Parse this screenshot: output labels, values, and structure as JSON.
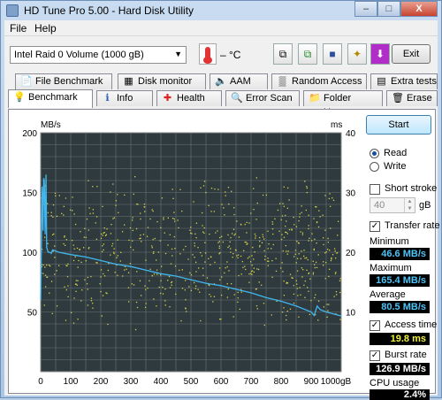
{
  "window": {
    "title": "HD Tune Pro 5.00 - Hard Disk Utility",
    "minimize": "–",
    "maximize": "□",
    "close": "X"
  },
  "menu": {
    "file": "File",
    "help": "Help"
  },
  "toolbar": {
    "drive": "Intel  Raid 0 Volume (1000 gB)",
    "temperature": "– °C",
    "exit_label": "Exit",
    "buttons": [
      "copy-icon",
      "copy-info-icon",
      "save-icon",
      "screenshot-icon",
      "download-icon"
    ]
  },
  "tabs_top": [
    {
      "label": "File Benchmark",
      "icon": "file-benchmark-icon",
      "glyph": "📄"
    },
    {
      "label": "Disk monitor",
      "icon": "disk-monitor-icon",
      "glyph": "▦"
    },
    {
      "label": "AAM",
      "icon": "speaker-icon",
      "glyph": "🔈"
    },
    {
      "label": "Random Access",
      "icon": "random-access-icon",
      "glyph": "▒"
    },
    {
      "label": "Extra tests",
      "icon": "extra-tests-icon",
      "glyph": "▤"
    }
  ],
  "tabs_bottom": [
    {
      "label": "Benchmark",
      "icon": "benchmark-icon",
      "glyph": "💡"
    },
    {
      "label": "Info",
      "icon": "info-icon",
      "glyph": "ℹ"
    },
    {
      "label": "Health",
      "icon": "health-icon",
      "glyph": "✚"
    },
    {
      "label": "Error Scan",
      "icon": "error-scan-icon",
      "glyph": "🔍"
    },
    {
      "label": "Folder Usage",
      "icon": "folder-icon",
      "glyph": "📁"
    },
    {
      "label": "Erase",
      "icon": "erase-icon",
      "glyph": "🗑"
    }
  ],
  "controls": {
    "start": "Start",
    "read": "Read",
    "write": "Write",
    "short_stroke": "Short stroke",
    "short_stroke_value": "40",
    "short_stroke_unit": "gB",
    "transfer_rate": "Transfer rate",
    "minimum_label": "Minimum",
    "minimum_value": "46.6 MB/s",
    "maximum_label": "Maximum",
    "maximum_value": "165.4 MB/s",
    "average_label": "Average",
    "average_value": "80.5 MB/s",
    "access_time": "Access time",
    "access_time_value": "19.8 ms",
    "burst_rate": "Burst rate",
    "burst_rate_value": "126.9 MB/s",
    "cpu_usage_label": "CPU usage",
    "cpu_usage_value": "2.4%"
  },
  "chart_data": {
    "type": "line",
    "left_unit": "MB/s",
    "right_unit": "ms",
    "x_ticks": [
      "0",
      "100",
      "200",
      "300",
      "400",
      "500",
      "600",
      "700",
      "800",
      "900",
      "1000gB"
    ],
    "left_ticks": [
      "200",
      "150",
      "100",
      "50"
    ],
    "right_ticks": [
      "40",
      "30",
      "20",
      "10"
    ],
    "xlim": [
      0,
      1000
    ],
    "ylim_left": [
      0,
      200
    ],
    "ylim_right": [
      0,
      40
    ],
    "grid": true,
    "series": [
      {
        "axis": "left",
        "color": "#3fb7f0",
        "x": [
          0,
          5,
          8,
          10,
          12,
          15,
          18,
          20,
          25,
          30,
          35,
          40,
          60,
          100,
          150,
          200,
          250,
          300,
          350,
          400,
          450,
          500,
          550,
          600,
          650,
          700,
          750,
          800,
          850,
          880,
          900,
          910,
          920,
          930,
          950,
          980,
          1000
        ],
        "y": [
          60,
          155,
          118,
          162,
          160,
          115,
          165,
          104,
          100,
          100,
          99,
          102,
          100,
          98,
          96,
          93,
          90,
          88,
          85,
          82,
          80,
          77,
          74,
          72,
          69,
          66,
          62,
          59,
          55,
          52,
          50,
          47,
          55,
          52,
          50,
          48,
          46.6
        ]
      }
    ],
    "scatter": {
      "axis": "right",
      "color": "#d8d24a",
      "x_range": [
        0,
        1000
      ],
      "y_range_ms": [
        7,
        33
      ],
      "count": 700
    }
  }
}
